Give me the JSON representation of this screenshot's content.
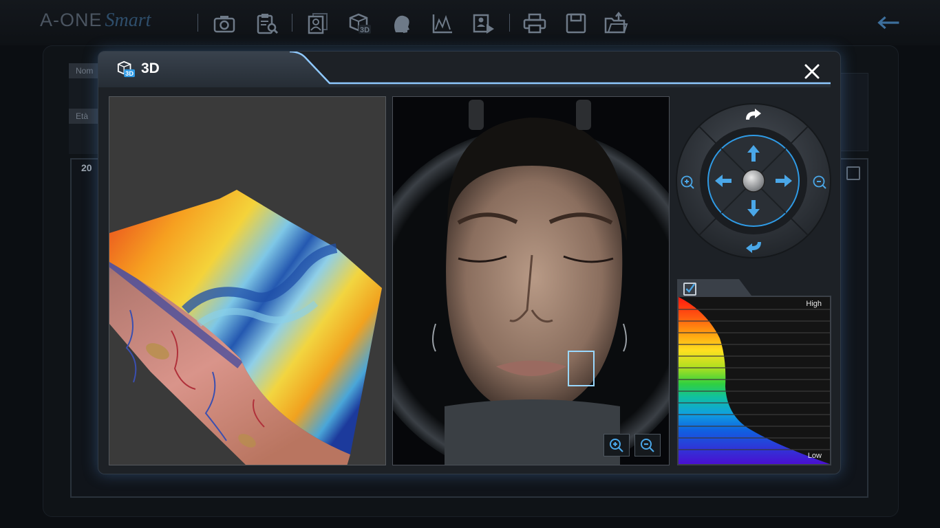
{
  "app": {
    "brand_main": "A-ONE",
    "brand_script": "Smart"
  },
  "toolbar": {
    "items": [
      {
        "name": "camera-icon",
        "label": "Capture"
      },
      {
        "name": "clipboard-search-icon",
        "label": "Analysis"
      },
      {
        "name": "portrait-icon",
        "label": "Profile"
      },
      {
        "name": "cube-3d-icon",
        "label": "3D"
      },
      {
        "name": "face-profile-icon",
        "label": "Face"
      },
      {
        "name": "chart-icon",
        "label": "Graph"
      },
      {
        "name": "video-document-icon",
        "label": "Report"
      },
      {
        "name": "print-icon",
        "label": "Print"
      },
      {
        "name": "save-icon",
        "label": "Save"
      },
      {
        "name": "folder-export-icon",
        "label": "Open"
      }
    ],
    "back_icon": "arrow-left-icon"
  },
  "background": {
    "label_name": "Nom",
    "label_age": "Età",
    "year_fragment": "20"
  },
  "modal": {
    "title": "3D",
    "title_icon": "cube-3d-icon",
    "close_icon": "close-icon"
  },
  "nav_wheel": {
    "rotate_cw_icon": "rotate-clockwise-icon",
    "rotate_ccw_icon": "rotate-counterclockwise-icon",
    "up_icon": "arrow-up-icon",
    "down_icon": "arrow-down-icon",
    "left_icon": "arrow-left-icon",
    "right_icon": "arrow-right-icon",
    "zoom_in_icon": "zoom-in-icon",
    "zoom_out_icon": "zoom-out-icon",
    "center_icon": "center-knob"
  },
  "legend": {
    "high_label": "High",
    "low_label": "Low",
    "checked": true
  },
  "face_view": {
    "zoom_in_icon": "zoom-in-icon",
    "zoom_out_icon": "zoom-out-icon"
  },
  "colors": {
    "accent": "#4aa7e8",
    "modal_bg": "#1d2126",
    "glow": "#5ab0ff"
  }
}
